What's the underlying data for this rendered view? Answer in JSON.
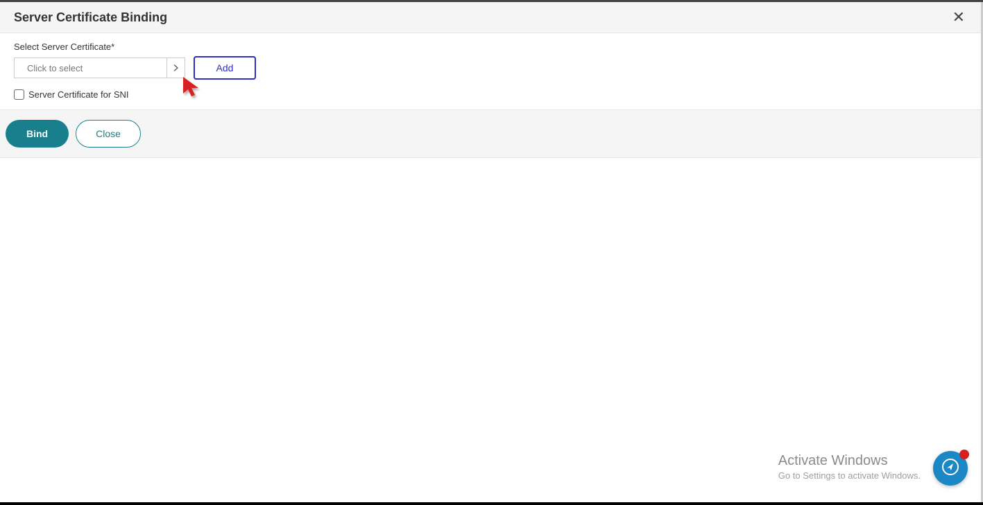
{
  "header": {
    "title": "Server Certificate Binding"
  },
  "form": {
    "field_label": "Select Server Certificate*",
    "select_placeholder": "Click to select",
    "add_label": "Add",
    "checkbox_label": "Server Certificate for SNI"
  },
  "footer": {
    "bind_label": "Bind",
    "close_label": "Close"
  },
  "watermark": {
    "title": "Activate Windows",
    "subtitle": "Go to Settings to activate Windows."
  }
}
